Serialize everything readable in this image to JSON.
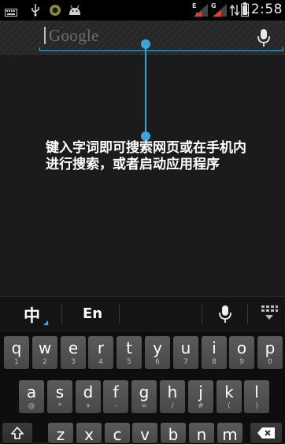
{
  "status_bar": {
    "time": "12:58",
    "signal1_label": "E",
    "signal2_label": "G",
    "icons": [
      "keyboard-icon",
      "usb-icon",
      "notification-icon",
      "android-icon",
      "signal-icon",
      "signal-icon",
      "data-transfer-icon",
      "battery-icon"
    ]
  },
  "search": {
    "placeholder": "Google",
    "mic_icon": "mic-icon"
  },
  "tutorial": {
    "hint": "键入字词即可搜索网页或在手机内进行搜索，或者启动应用程序"
  },
  "ime": {
    "chinese_label": "中",
    "english_label": "En",
    "voice_icon": "mic-icon",
    "keyboard_icon": "keyboard-icon"
  },
  "keyboard": {
    "row1": [
      {
        "k": "q",
        "s": "1"
      },
      {
        "k": "w",
        "s": "2"
      },
      {
        "k": "e",
        "s": "3"
      },
      {
        "k": "r",
        "s": "4"
      },
      {
        "k": "t",
        "s": "5"
      },
      {
        "k": "y",
        "s": "6"
      },
      {
        "k": "u",
        "s": "7"
      },
      {
        "k": "i",
        "s": "8"
      },
      {
        "k": "o",
        "s": "9"
      },
      {
        "k": "p",
        "s": "0"
      }
    ],
    "row2": [
      {
        "k": "a",
        "s": "@"
      },
      {
        "k": "s",
        "s": "*"
      },
      {
        "k": "d",
        "s": "+"
      },
      {
        "k": "f",
        "s": "-"
      },
      {
        "k": "g",
        "s": "="
      },
      {
        "k": "h",
        "s": "/"
      },
      {
        "k": "j",
        "s": "#"
      },
      {
        "k": "k",
        "s": "("
      },
      {
        "k": "l",
        "s": ")"
      }
    ],
    "row3": [
      {
        "k": "z",
        "s": ""
      },
      {
        "k": "x",
        "s": ""
      },
      {
        "k": "c",
        "s": ""
      },
      {
        "k": "v",
        "s": ""
      },
      {
        "k": "b",
        "s": ""
      },
      {
        "k": "n",
        "s": ""
      },
      {
        "k": "m",
        "s": ""
      }
    ],
    "shift_icon": "shift-icon",
    "backspace_icon": "backspace-icon"
  },
  "colors": {
    "accent": "#3aa5d8",
    "background": "#1b1b1b"
  }
}
